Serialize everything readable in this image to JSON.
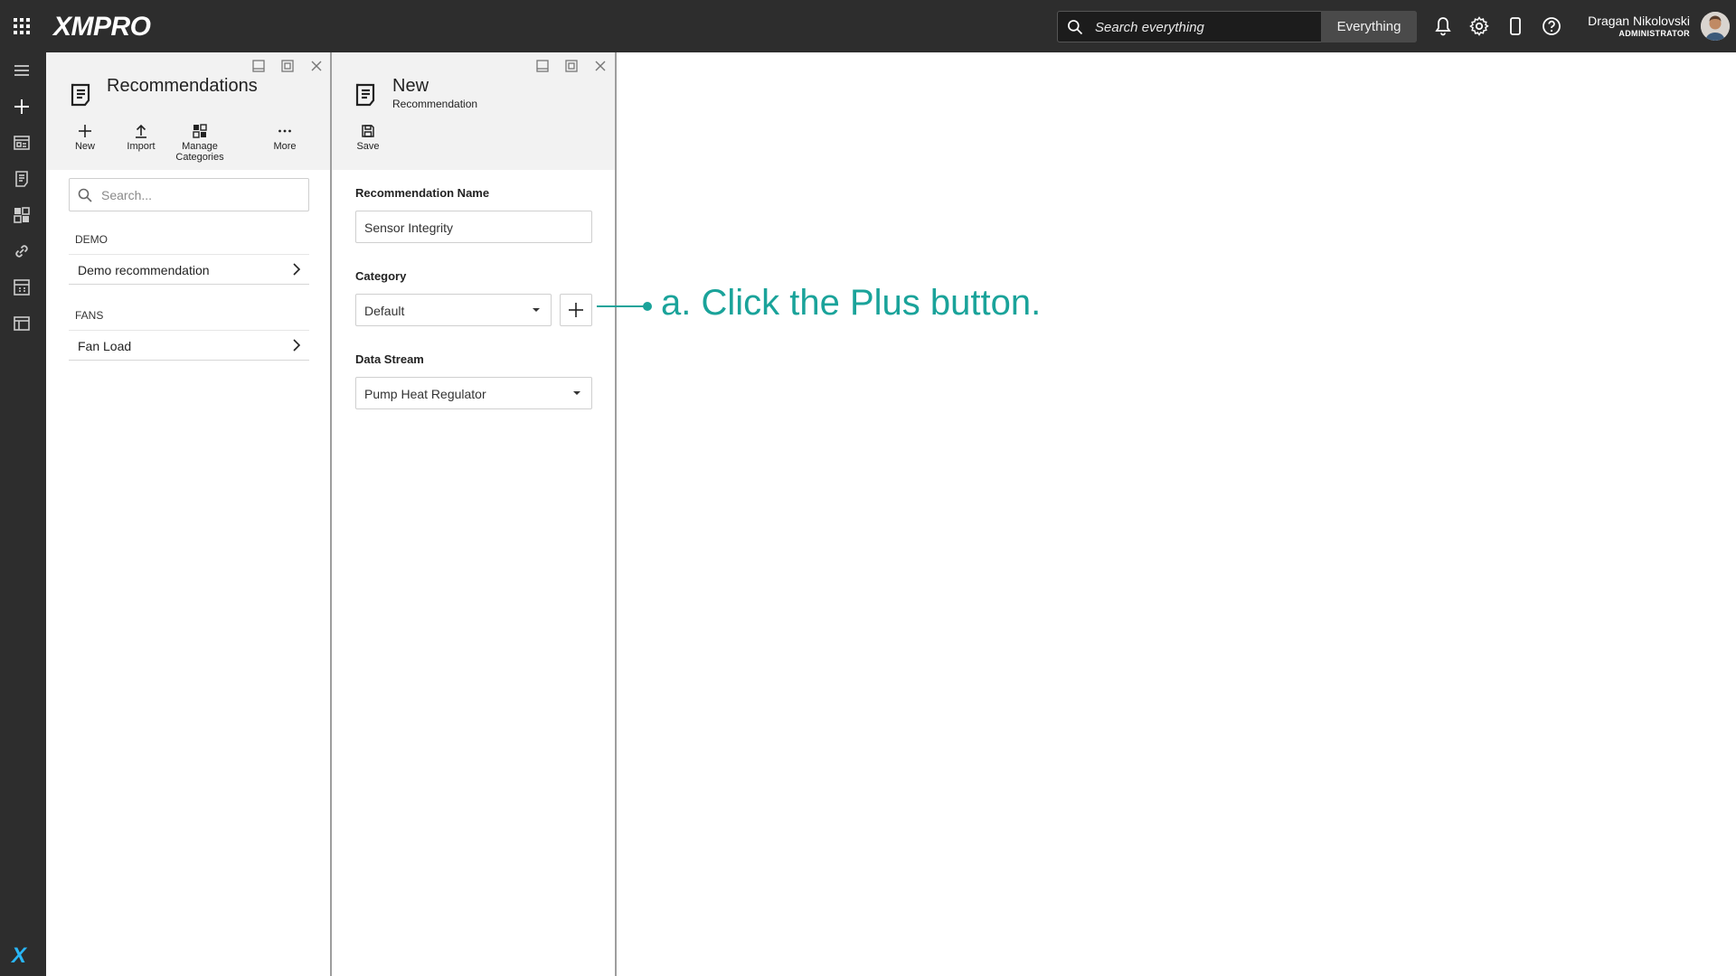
{
  "app": {
    "logo": "XMPRO"
  },
  "search": {
    "placeholder": "Search everything",
    "scope": "Everything"
  },
  "user": {
    "name": "Dragan Nikolovski",
    "role": "ADMINISTRATOR"
  },
  "list_panel": {
    "title": "Recommendations",
    "toolbar": {
      "new": "New",
      "import": "Import",
      "manage_line1": "Manage",
      "manage_line2": "Categories",
      "more": "More"
    },
    "search_placeholder": "Search...",
    "groups": [
      {
        "label": "DEMO",
        "items": [
          "Demo recommendation"
        ]
      },
      {
        "label": "FANS",
        "items": [
          "Fan Load"
        ]
      }
    ]
  },
  "edit_panel": {
    "title": "New",
    "subtitle": "Recommendation",
    "toolbar": {
      "save": "Save"
    },
    "fields": {
      "name_label": "Recommendation Name",
      "name_value": "Sensor Integrity",
      "category_label": "Category",
      "category_value": "Default",
      "stream_label": "Data Stream",
      "stream_value": "Pump Heat Regulator"
    }
  },
  "annotation": {
    "text": "a. Click the Plus button.",
    "color": "#1aa39a"
  },
  "colors": {
    "chrome": "#2d2d2d",
    "panel_header": "#f2f2f2",
    "brand_x": "#29b6f6"
  }
}
